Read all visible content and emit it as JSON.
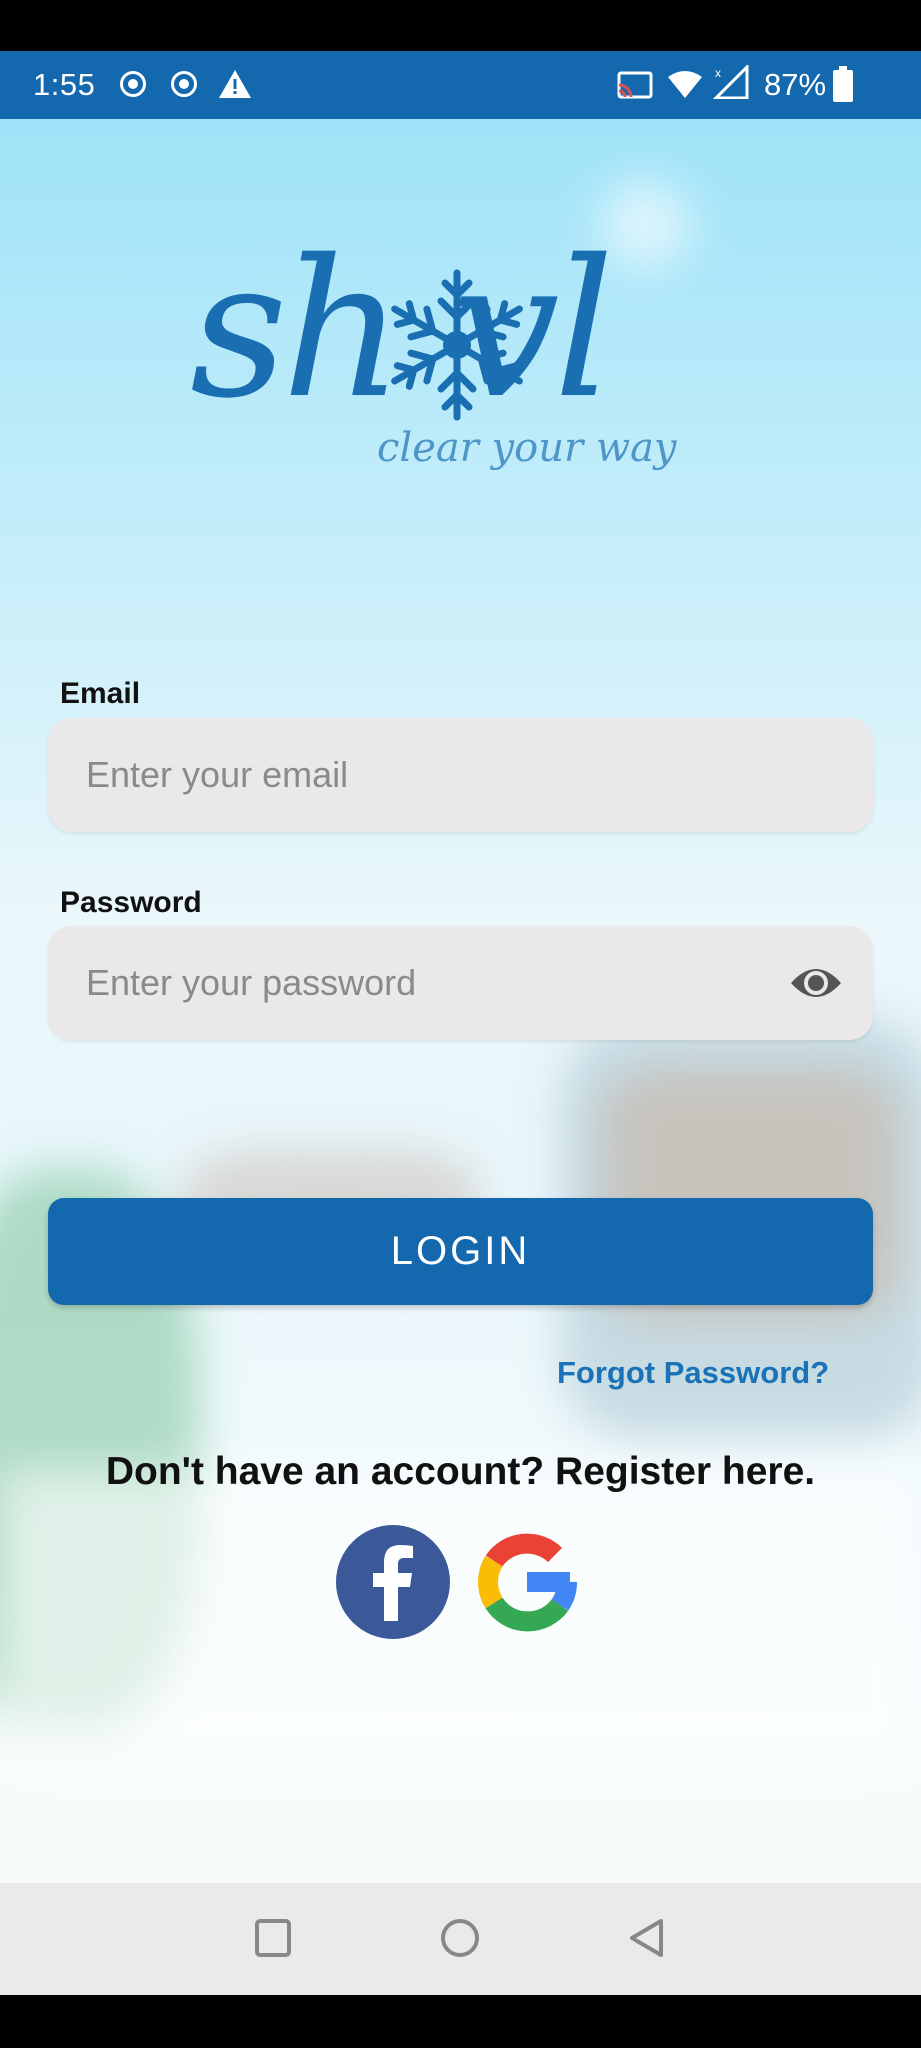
{
  "status_bar": {
    "time": "1:55",
    "battery_percent": "87%",
    "icons": [
      "record-icon",
      "record-icon",
      "warning-icon",
      "cast-icon",
      "wifi-icon",
      "signal-icon",
      "battery-icon"
    ],
    "color": "#1468ad"
  },
  "logo": {
    "text": "sh vl",
    "tagline": "clear your way",
    "icon": "snowflake-icon"
  },
  "form": {
    "email": {
      "label": "Email",
      "placeholder": "Enter your email",
      "value": ""
    },
    "password": {
      "label": "Password",
      "placeholder": "Enter your password",
      "value": "",
      "toggle_icon": "eye-icon"
    },
    "login_label": "LOGIN",
    "forgot_label": "Forgot Password?",
    "register_label": "Don't have an account? Register here."
  },
  "social": {
    "facebook_icon": "facebook-icon",
    "google_icon": "google-icon"
  },
  "nav_bar": {
    "icons": [
      "recents-icon",
      "home-icon",
      "back-icon"
    ]
  },
  "colors": {
    "accent": "#1468ad",
    "link": "#1a73b8",
    "field_bg": "#ebe8ea"
  }
}
